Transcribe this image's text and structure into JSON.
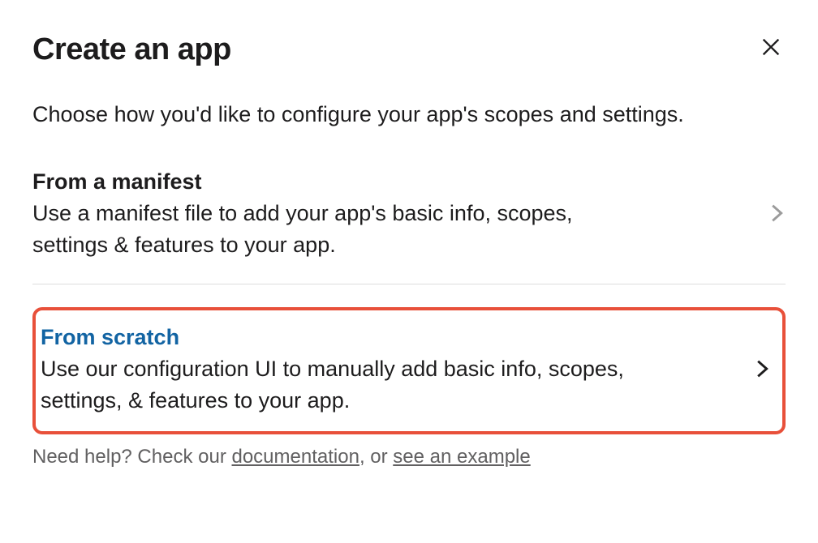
{
  "title": "Create an app",
  "subtitle": "Choose how you'd like to configure your app's scopes and settings.",
  "options": {
    "manifest": {
      "title": "From a manifest",
      "desc": "Use a manifest file to add your app's basic info, scopes, settings & features to your app."
    },
    "scratch": {
      "title": "From scratch",
      "desc": "Use our configuration UI to manually add basic info, scopes, settings, & features to your app."
    }
  },
  "footer": {
    "prefix": "Need help? Check our ",
    "doc_link": "documentation",
    "middle": ", or ",
    "example_link": "see an example"
  }
}
